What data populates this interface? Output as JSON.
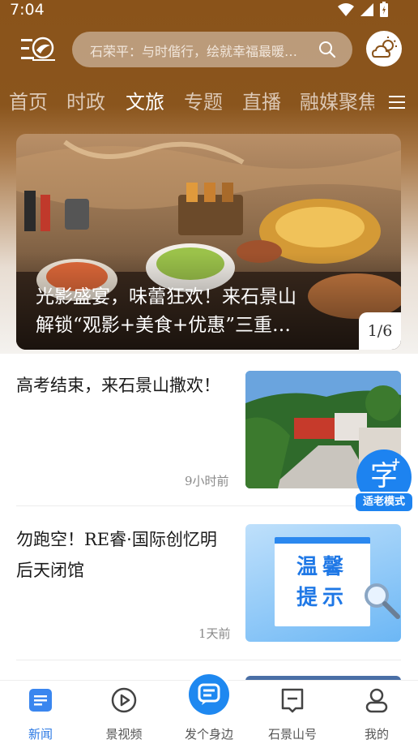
{
  "status": {
    "time": "7:04"
  },
  "header": {
    "search_placeholder": "石荣平：与时偕行，绘就幸福最暖…"
  },
  "tabs": [
    "首页",
    "时政",
    "文旅",
    "专题",
    "直播",
    "融媒聚焦"
  ],
  "active_tab": "文旅",
  "banner": {
    "title_line1": "光影盛宴，味蕾狂欢！来石景山",
    "title_line2": "解锁“观影+美食+优惠”三重…",
    "pager": "1/6"
  },
  "news": [
    {
      "title": "高考结束，来石景山撒欢！",
      "time": "9小时前"
    },
    {
      "title": "勿跑空！RE睿·国际创忆明后天闭馆",
      "time": "1天前",
      "thumb_text_1": "温馨",
      "thumb_text_2": "提示"
    }
  ],
  "elder_mode": {
    "glyph": "字",
    "plus": "+",
    "label": "适老模式"
  },
  "navbar": {
    "items": [
      {
        "label": "新闻"
      },
      {
        "label": "景视频"
      },
      {
        "label": "发个身边"
      },
      {
        "label": "石景山号"
      },
      {
        "label": "我的"
      }
    ]
  },
  "colors": {
    "brand_brown": "#8a531a",
    "accent_blue": "#1e88f0"
  }
}
